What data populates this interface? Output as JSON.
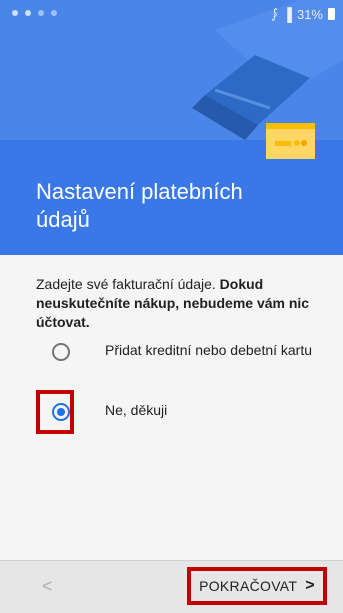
{
  "status": {
    "signal_icon": "wifi-icon",
    "battery": "31%"
  },
  "header": {
    "title": "Nastavení platebních údajů",
    "bg_color": "#4a86e8",
    "illustration": "payment-cards-illustration"
  },
  "content": {
    "desc_normal": "Zadejte své fakturační údaje. ",
    "desc_bold": "Dokud neuskutečníte nákup, nebudeme vám nic účtovat.",
    "options": [
      {
        "label": "Přidat kreditní nebo debetní kartu",
        "selected": false
      },
      {
        "label": "Ne, děkuji",
        "selected": true
      }
    ]
  },
  "footer": {
    "back_label": "<",
    "next_label": "POKRAČOVAT",
    "next_chevron": ">"
  },
  "colors": {
    "accent": "#1a73e8",
    "highlight": "#c00000"
  }
}
